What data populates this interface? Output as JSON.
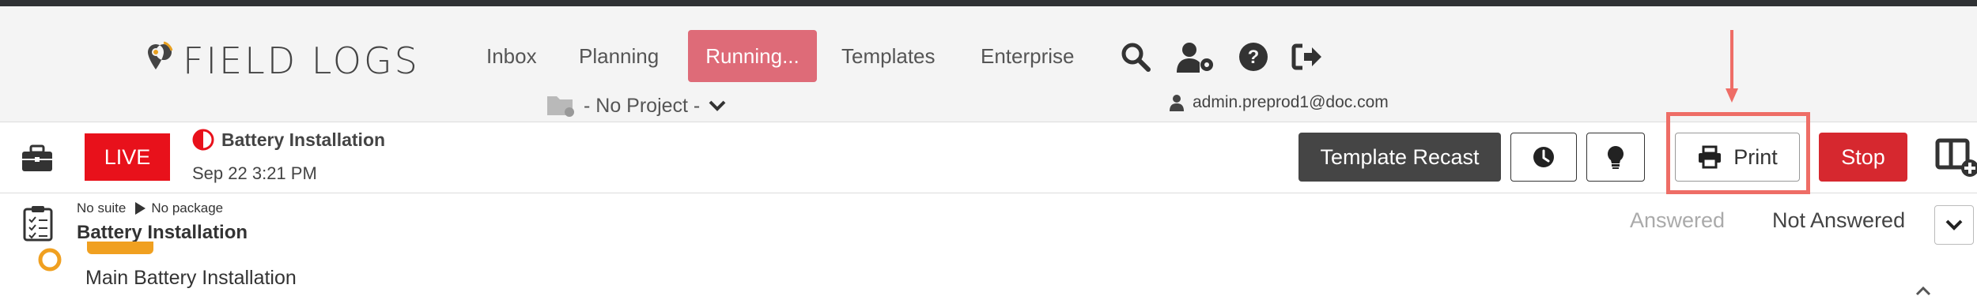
{
  "brand": {
    "name": "FIELD LOGS"
  },
  "nav": {
    "items": [
      {
        "label": "Inbox"
      },
      {
        "label": "Planning"
      },
      {
        "label": "Running..."
      },
      {
        "label": "Templates"
      },
      {
        "label": "Enterprise"
      }
    ]
  },
  "project": {
    "label": "- No Project -"
  },
  "user": {
    "email": "admin.preprod1@doc.com"
  },
  "run": {
    "status": "LIVE",
    "title": "Battery Installation",
    "date": "Sep 22 3:21 PM"
  },
  "toolbar": {
    "template_recast": "Template Recast",
    "print": "Print",
    "stop": "Stop"
  },
  "suite": {
    "suite_label": "No suite",
    "package_label": "No package",
    "title": "Battery Installation"
  },
  "filters": {
    "answered": "Answered",
    "not_answered": "Not Answered"
  },
  "task": {
    "name": "Main Battery Installation"
  },
  "colors": {
    "accent": "#de6b78",
    "live": "#e8111b",
    "stop": "#d6282f",
    "highlight": "#ee6d66",
    "warning": "#f0a020"
  }
}
